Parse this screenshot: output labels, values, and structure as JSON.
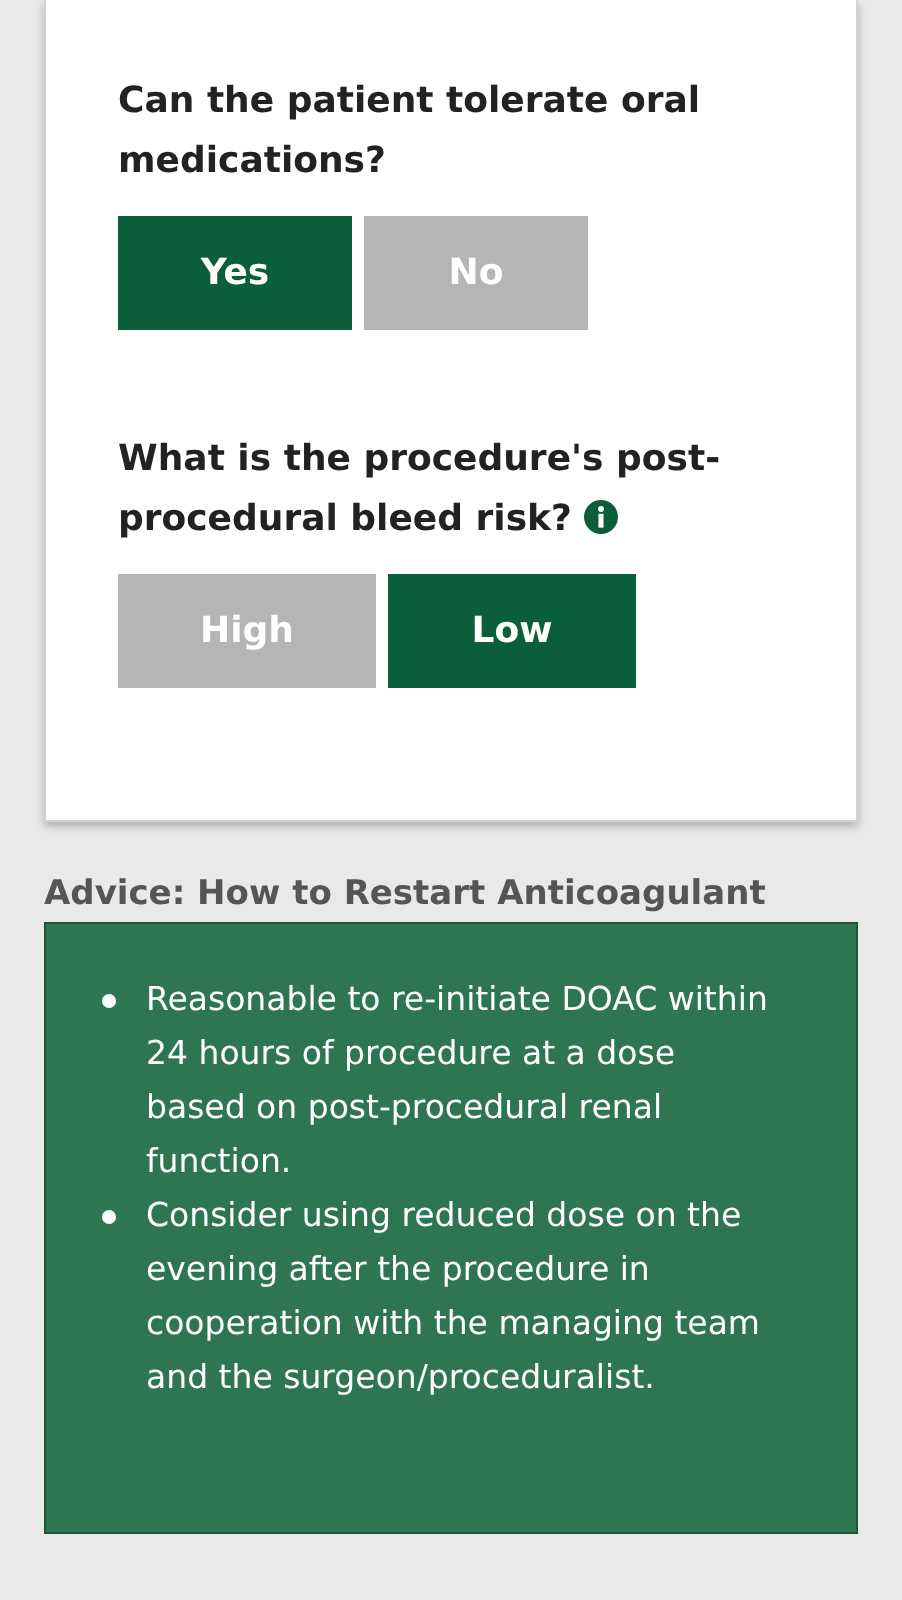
{
  "questions": [
    {
      "text": "Can the patient tolerate oral medications?",
      "info": false,
      "options": [
        {
          "label": "Yes",
          "selected": true
        },
        {
          "label": "No",
          "selected": false
        }
      ]
    },
    {
      "text": "What is the procedure's post-procedural bleed risk?",
      "info": true,
      "options": [
        {
          "label": "High",
          "selected": false
        },
        {
          "label": "Low",
          "selected": true
        }
      ]
    }
  ],
  "advice": {
    "title": "Advice: How to Restart Anticoagulant",
    "items": [
      "Reasonable to re-initiate DOAC within 24 hours of procedure at a dose based on post-procedural renal function.",
      "Consider using reduced dose on the evening after the procedure in cooperation with the managing team and the surgeon/proceduralist."
    ]
  }
}
